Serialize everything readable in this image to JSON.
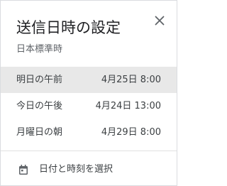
{
  "dialog": {
    "title": "送信日時の設定",
    "timezone": "日本標準時",
    "close_icon": "close-icon"
  },
  "options": [
    {
      "label": "明日の午前",
      "time": "4月25日 8:00",
      "selected": true
    },
    {
      "label": "今日の午後",
      "time": "4月24日 13:00",
      "selected": false
    },
    {
      "label": "月曜日の朝",
      "time": "4月29日 8:00",
      "selected": false
    }
  ],
  "pick_custom": {
    "label": "日付と時刻を選択",
    "icon": "calendar-icon"
  },
  "colors": {
    "selected_background": "#e8e8e8",
    "text_primary": "#202124",
    "text_secondary": "#5f6368",
    "icon": "#5f6368"
  }
}
